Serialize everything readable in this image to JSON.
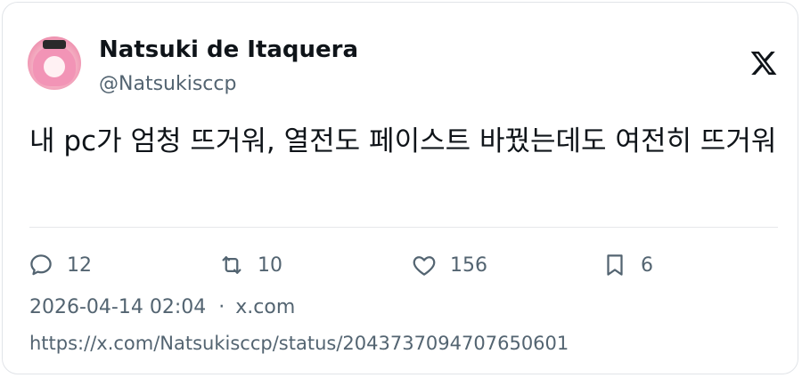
{
  "author": {
    "display_name": "Natsuki de Itaquera",
    "handle": "@Natsukisccp"
  },
  "platform_icon": "x-logo-icon",
  "tweet": {
    "text": "내 pc가 엄청 뜨거워, 열전도 페이스트 바꿨는데도 여전히 뜨거워"
  },
  "actions": {
    "replies": {
      "icon": "reply-icon",
      "count": "12"
    },
    "reposts": {
      "icon": "repost-icon",
      "count": "10"
    },
    "likes": {
      "icon": "heart-icon",
      "count": "156"
    },
    "bookmarks": {
      "icon": "bookmark-icon",
      "count": "6"
    }
  },
  "meta": {
    "timestamp": "2026-04-14 02:04",
    "separator": "·",
    "source": "x.com"
  },
  "status_url": "https://x.com/Natsukisccp/status/2043737094707650601",
  "colors": {
    "text_primary": "#0f1419",
    "text_secondary": "#536471",
    "border": "#e1e4e8"
  }
}
